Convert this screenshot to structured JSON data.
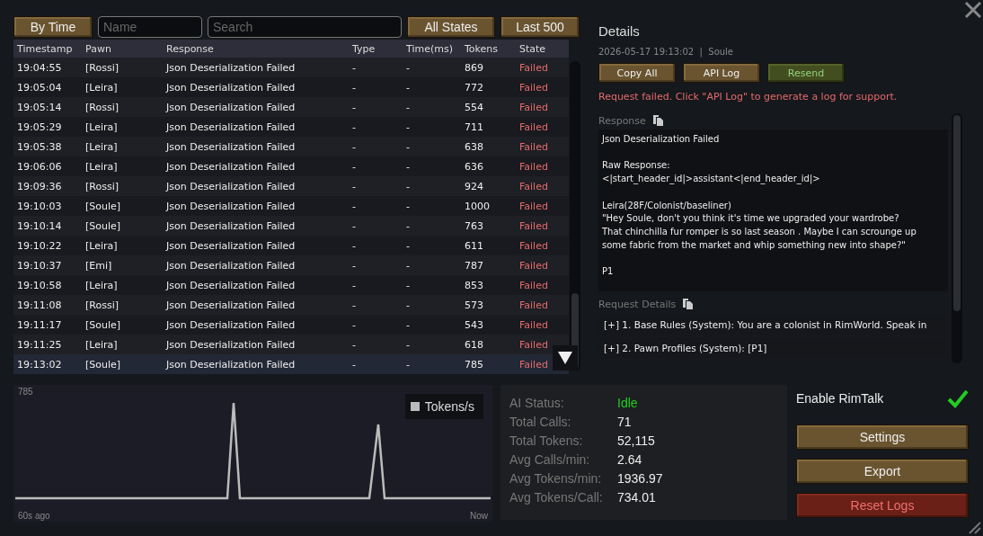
{
  "toolbar": {
    "sort_button": "By Time",
    "name_field": {
      "placeholder": "Name"
    },
    "search_field": {
      "placeholder": "Search"
    },
    "states_button": "All States",
    "limit_button": "Last 500"
  },
  "table": {
    "columns": [
      "Timestamp",
      "Pawn",
      "Response",
      "Type",
      "Time(ms)",
      "Tokens",
      "State"
    ],
    "rows": [
      {
        "timestamp": "19:04:55",
        "pawn": "[Rossi]",
        "response": "Json Deserialization Failed",
        "type": "-",
        "time_ms": "-",
        "tokens": "869",
        "state": "Failed",
        "failed": true,
        "selected": false
      },
      {
        "timestamp": "19:05:04",
        "pawn": "[Leira]",
        "response": "Json Deserialization Failed",
        "type": "-",
        "time_ms": "-",
        "tokens": "772",
        "state": "Failed",
        "failed": true,
        "selected": false
      },
      {
        "timestamp": "19:05:14",
        "pawn": "[Rossi]",
        "response": "Json Deserialization Failed",
        "type": "-",
        "time_ms": "-",
        "tokens": "554",
        "state": "Failed",
        "failed": true,
        "selected": false
      },
      {
        "timestamp": "19:05:29",
        "pawn": "[Leira]",
        "response": "Json Deserialization Failed",
        "type": "-",
        "time_ms": "-",
        "tokens": "711",
        "state": "Failed",
        "failed": true,
        "selected": false
      },
      {
        "timestamp": "19:05:38",
        "pawn": "[Leira]",
        "response": "Json Deserialization Failed",
        "type": "-",
        "time_ms": "-",
        "tokens": "638",
        "state": "Failed",
        "failed": true,
        "selected": false
      },
      {
        "timestamp": "19:06:06",
        "pawn": "[Leira]",
        "response": "Json Deserialization Failed",
        "type": "-",
        "time_ms": "-",
        "tokens": "636",
        "state": "Failed",
        "failed": true,
        "selected": false
      },
      {
        "timestamp": "19:09:36",
        "pawn": "[Rossi]",
        "response": "Json Deserialization Failed",
        "type": "-",
        "time_ms": "-",
        "tokens": "924",
        "state": "Failed",
        "failed": true,
        "selected": false
      },
      {
        "timestamp": "19:10:03",
        "pawn": "[Soule]",
        "response": "Json Deserialization Failed",
        "type": "-",
        "time_ms": "-",
        "tokens": "1000",
        "state": "Failed",
        "failed": true,
        "selected": false
      },
      {
        "timestamp": "19:10:14",
        "pawn": "[Soule]",
        "response": "Json Deserialization Failed",
        "type": "-",
        "time_ms": "-",
        "tokens": "763",
        "state": "Failed",
        "failed": true,
        "selected": false
      },
      {
        "timestamp": "19:10:22",
        "pawn": "[Leira]",
        "response": "Json Deserialization Failed",
        "type": "-",
        "time_ms": "-",
        "tokens": "611",
        "state": "Failed",
        "failed": true,
        "selected": false
      },
      {
        "timestamp": "19:10:37",
        "pawn": "[Emi]",
        "response": "Json Deserialization Failed",
        "type": "-",
        "time_ms": "-",
        "tokens": "787",
        "state": "Failed",
        "failed": true,
        "selected": false
      },
      {
        "timestamp": "19:10:58",
        "pawn": "[Leira]",
        "response": "Json Deserialization Failed",
        "type": "-",
        "time_ms": "-",
        "tokens": "853",
        "state": "Failed",
        "failed": true,
        "selected": false
      },
      {
        "timestamp": "19:11:08",
        "pawn": "[Rossi]",
        "response": "Json Deserialization Failed",
        "type": "-",
        "time_ms": "-",
        "tokens": "573",
        "state": "Failed",
        "failed": true,
        "selected": false
      },
      {
        "timestamp": "19:11:17",
        "pawn": "[Soule]",
        "response": "Json Deserialization Failed",
        "type": "-",
        "time_ms": "-",
        "tokens": "543",
        "state": "Failed",
        "failed": true,
        "selected": false
      },
      {
        "timestamp": "19:11:25",
        "pawn": "[Leira]",
        "response": "Json Deserialization Failed",
        "type": "-",
        "time_ms": "-",
        "tokens": "618",
        "state": "Failed",
        "failed": true,
        "selected": false
      },
      {
        "timestamp": "19:13:02",
        "pawn": "[Soule]",
        "response": "Json Deserialization Failed",
        "type": "-",
        "time_ms": "-",
        "tokens": "785",
        "state": "Failed",
        "failed": true,
        "selected": true
      }
    ]
  },
  "details": {
    "title": "Details",
    "meta": "2026-05-17 19:13:02  |  Soule",
    "buttons": [
      {
        "label": "Copy All",
        "kind": "normal"
      },
      {
        "label": "API Log",
        "kind": "normal"
      },
      {
        "label": "Resend",
        "kind": "accent"
      }
    ],
    "error": "Request failed. Click \"API Log\" to generate a log for support.",
    "response_label": "Response",
    "response_text": "Json Deserialization Failed\n\nRaw Response:\n<|start_header_id|>assistant<|end_header_id|>\n\nLeira(28F/Colonist/baseliner)\n\"Hey Soule, don't you think it's time we upgraded your wardrobe?\nThat chinchilla fur romper is so last season . Maybe I can scrounge up\nsome fabric from the market and whip something new into shape?\"\n\nP1",
    "request_label": "Request Details",
    "request_items": [
      "[+] 1. Base Rules (System): You are a colonist in RimWorld. Speak in",
      "[+] 2. Pawn Profiles (System): [P1]"
    ]
  },
  "chart": {
    "max_label": "785",
    "legend": "Tokens/s",
    "x_start": "60s ago",
    "x_end": "Now"
  },
  "stats": [
    {
      "label": "AI Status:",
      "value": "Idle",
      "kind": "status"
    },
    {
      "label": "Total Calls:",
      "value": "71",
      "kind": "number"
    },
    {
      "label": "Total Tokens:",
      "value": "52,115",
      "kind": "number"
    },
    {
      "label": "Avg Calls/min:",
      "value": "2.64",
      "kind": "number"
    },
    {
      "label": "Avg Tokens/min:",
      "value": "1936.97",
      "kind": "number"
    },
    {
      "label": "Avg Tokens/Call:",
      "value": "734.01",
      "kind": "number"
    }
  ],
  "enable": {
    "label": "Enable RimTalk",
    "checked": true
  },
  "actions": [
    {
      "label": "Settings",
      "kind": "normal"
    },
    {
      "label": "Export",
      "kind": "normal"
    },
    {
      "label": "Reset Logs",
      "kind": "danger"
    }
  ]
}
